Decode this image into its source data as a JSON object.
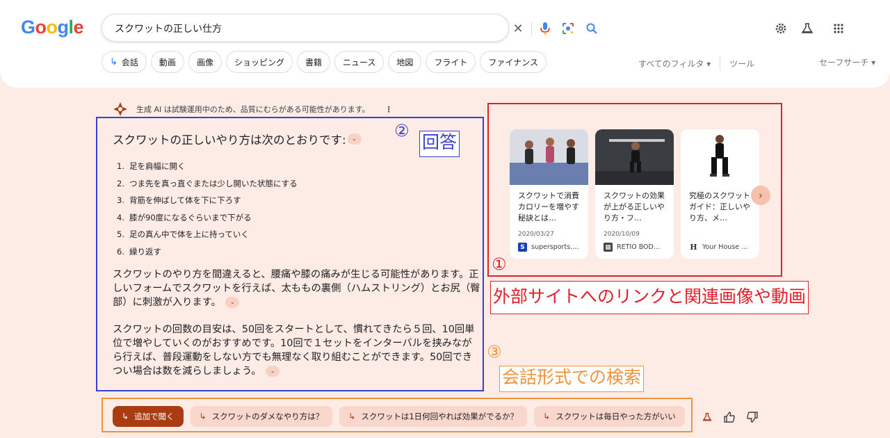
{
  "logo": {
    "text": "Google"
  },
  "search": {
    "query": "スクワットの正しい仕方",
    "clear_glyph": "✕",
    "icons": [
      "close-icon",
      "microphone-icon",
      "lens-icon",
      "search-icon"
    ]
  },
  "header_icons": [
    "gear-icon",
    "labs-flask-icon",
    "apps-grid-icon"
  ],
  "chips": [
    {
      "label": "会話",
      "arrow": "↳"
    },
    {
      "label": "動画"
    },
    {
      "label": "画像"
    },
    {
      "label": "ショッピング"
    },
    {
      "label": "書籍"
    },
    {
      "label": "ニュース"
    },
    {
      "label": "地図"
    },
    {
      "label": "フライト"
    },
    {
      "label": "ファイナンス"
    }
  ],
  "filters": {
    "all": "すべてのフィルタ ▾",
    "tools": "ツール",
    "safesearch": "セーフサーチ ▾"
  },
  "ai_notice": {
    "text": "生成 AI は試験運用中のため、品質にむらがある可能性があります。",
    "more": "⋮"
  },
  "answer": {
    "heading": "スクワットの正しいやり方は次のとおりです:",
    "expand": "⌄",
    "steps": [
      {
        "n": "1.",
        "text": "足を肩幅に開く"
      },
      {
        "n": "2.",
        "text": "つま先を真っ直ぐまたは少し開いた状態にする"
      },
      {
        "n": "3.",
        "text": "背筋を伸ばして体を下に下ろす"
      },
      {
        "n": "4.",
        "text": "膝が90度になるぐらいまで下がる"
      },
      {
        "n": "5.",
        "text": "足の真ん中で体を上に持っていく"
      },
      {
        "n": "6.",
        "text": "繰り返す"
      }
    ],
    "para1": "スクワットのやり方を間違えると、腰痛や膝の痛みが生じる可能性があります。正しいフォームでスクワットを行えば、太ももの裏側（ハムストリング）とお尻（臀部）に刺激が入ります。",
    "para2": "スクワットの回数の目安は、50回をスタートとして、慣れてきたら５回、10回単位で増やしていくのがおすすめです。10回で１セットをインターバルを挟みながら行えば、普段運動をしない方でも無理なく取り組むことができます。50回できつい場合は数を減らしましょう。"
  },
  "cards": [
    {
      "title": "スクワットで消費カロリーを増やす秘訣とは…",
      "date": "2020/03/27",
      "source": "supersports.…",
      "fav": "S",
      "fav_color": "#1a3fb4"
    },
    {
      "title": "スクワットの効果が上がる正しいやり方・フ…",
      "date": "2020/10/09",
      "source": "RETIO BOD…",
      "fav": "▦",
      "fav_color": "#444444"
    },
    {
      "title": "究極のスクワットガイド：正しいやり方、メ…",
      "date": "",
      "source": "Your House …",
      "fav": "H",
      "fav_color": "#ffffff"
    }
  ],
  "next_glyph": "›",
  "annotations": {
    "one_num": "①",
    "one_label": "外部サイトへのリンクと関連画像や動画",
    "two_num": "②",
    "two_label": "回答",
    "three_num": "③",
    "three_label": "会話形式での検索"
  },
  "followups": {
    "primary": "追加で聞く",
    "arrow": "↳",
    "suggestions": [
      "スクワットのダメなやり方は？",
      "スクワットは1日何回やれば効果がでるか？",
      "スクワットは毎日やった方がいい"
    ]
  },
  "feedback_icons": [
    "labs-flask-icon",
    "thumbs-up-icon",
    "thumbs-down-icon"
  ],
  "colors": {
    "annotation_red": "#e0202a",
    "annotation_blue": "#3b3fcf",
    "annotation_orange": "#f0923c",
    "ai_accent": "#a93c12"
  }
}
